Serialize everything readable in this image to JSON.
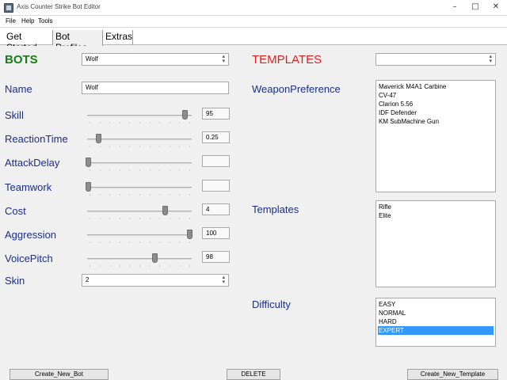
{
  "window": {
    "title": "Axis Counter Strike Bot Editor",
    "controls": {
      "minimize": "–",
      "maximize": "□",
      "close": "✕"
    }
  },
  "menu": {
    "items": [
      "File",
      "Help",
      "Tools"
    ]
  },
  "tabs": [
    "Get Started",
    "Bot Profiles",
    "Extras"
  ],
  "active_tab": "Bot Profiles",
  "colors": {
    "bots_heading": "#1a7a1a",
    "templates_heading": "#e02020",
    "field_label": "#1a2e8c",
    "selection": "#3399ff"
  },
  "bots": {
    "heading": "BOTS",
    "selected": "Wolf",
    "name_label": "Name",
    "name_value": "Wolf",
    "sliders": [
      {
        "label": "Skill",
        "value": "95",
        "level": 0.95
      },
      {
        "label": "ReactionTime",
        "value": "0.25",
        "level": 0.1
      },
      {
        "label": "AttackDelay",
        "value": "",
        "level": 0.0
      },
      {
        "label": "Teamwork",
        "value": "",
        "level": 0.0
      },
      {
        "label": "Cost",
        "value": "4",
        "level": 0.76
      },
      {
        "label": "Aggression",
        "value": "100",
        "level": 1.0
      },
      {
        "label": "VoicePitch",
        "value": "98",
        "level": 0.66
      }
    ],
    "skin_label": "Skin",
    "skin_value": "2"
  },
  "templates": {
    "heading": "TEMPLATES",
    "selected": "",
    "weapon_label": "WeaponPreference",
    "weapons": [
      "Maverick M4A1 Carbine",
      "CV-47",
      "Clarion 5.56",
      "IDF Defender",
      "KM SubMachine Gun"
    ],
    "templates_label": "Templates",
    "template_items": [
      "Rifle",
      "Elite"
    ],
    "difficulty_label": "Difficulty",
    "difficulty_items": [
      "EASY",
      "NORMAL",
      "HARD",
      "EXPERT"
    ],
    "difficulty_selected": "EXPERT"
  },
  "buttons": {
    "create_bot": "Create_New_Bot",
    "delete": "DELETE",
    "create_template": "Create_New_Template"
  }
}
